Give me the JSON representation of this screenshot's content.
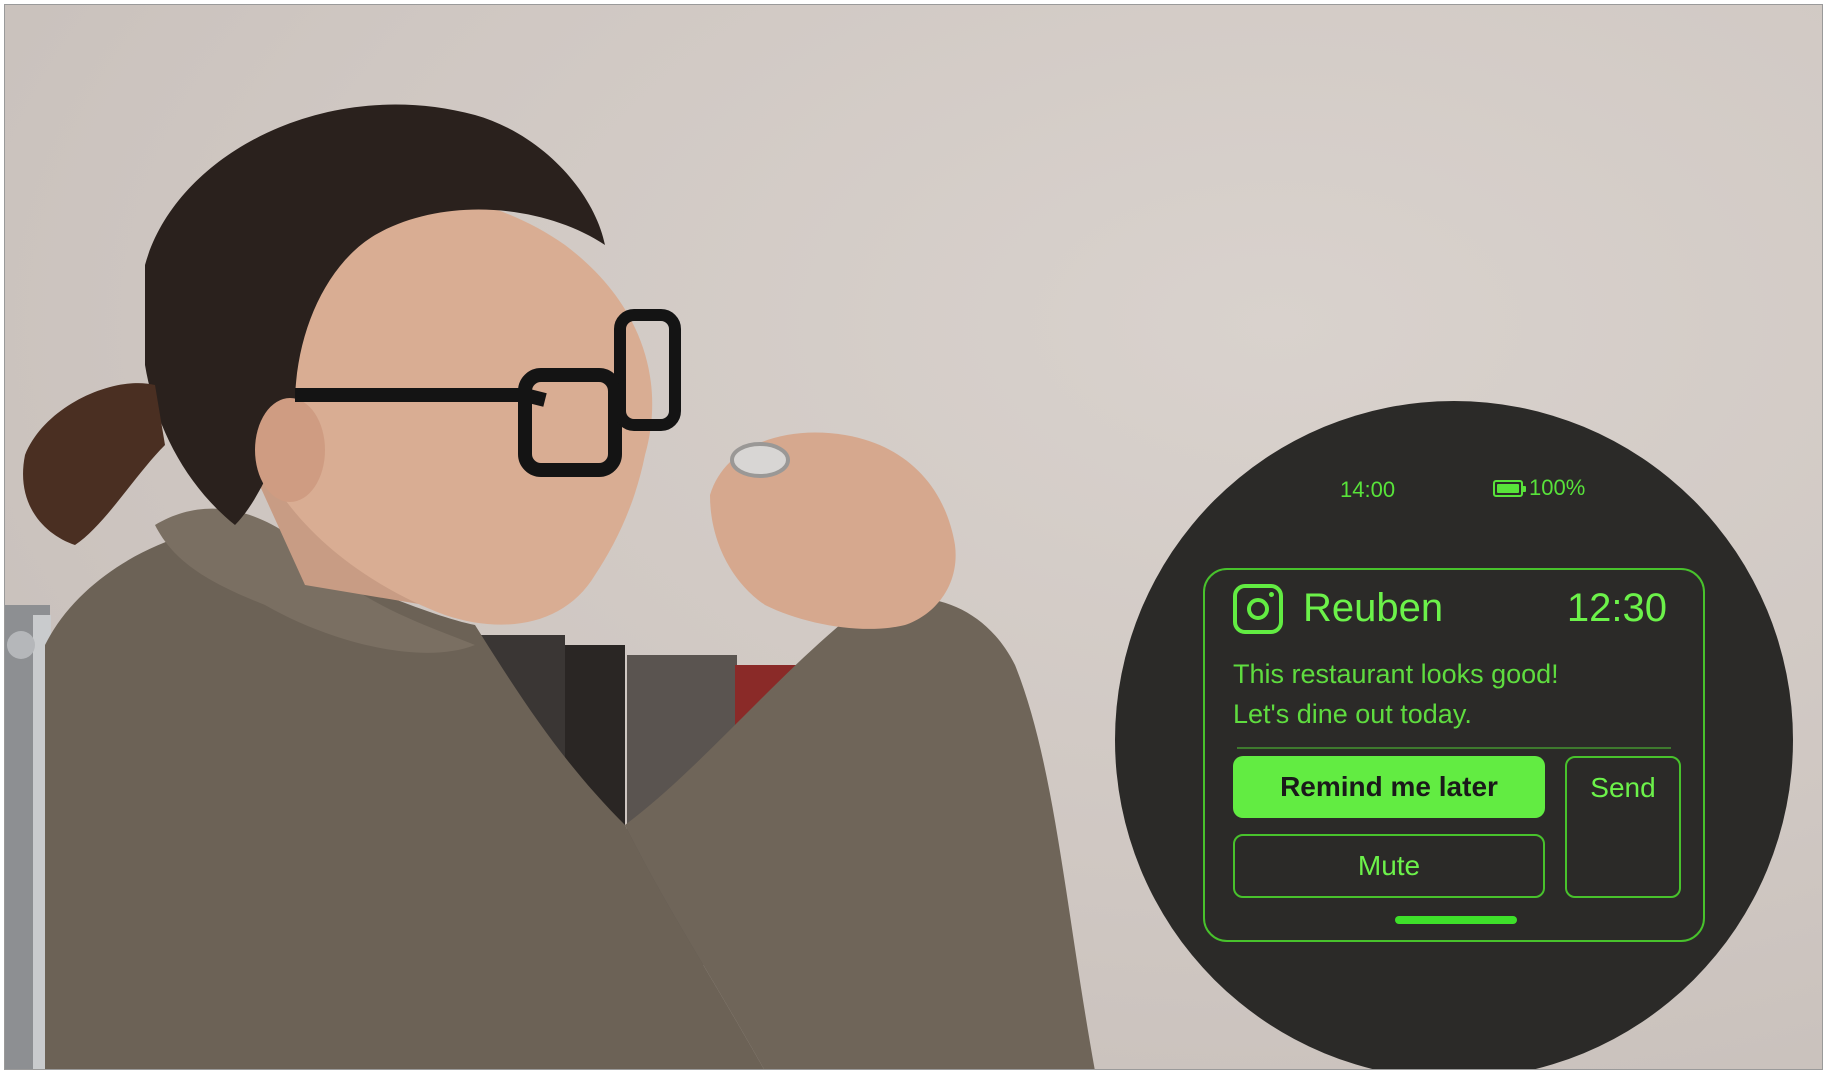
{
  "status_bar": {
    "time": "14:00",
    "battery": "100%",
    "battery_icon": "battery-full-icon"
  },
  "notification": {
    "app_icon": "instagram-icon",
    "sender": "Reuben",
    "time": "12:30",
    "message_line1": "This restaurant looks good!",
    "message_line2": "Let's dine out today."
  },
  "actions": {
    "remind_label": "Remind me later",
    "send_label": "Send",
    "mute_label": "Mute"
  },
  "colors": {
    "accent": "#62ec42",
    "hud_background": "#2b2a28"
  }
}
